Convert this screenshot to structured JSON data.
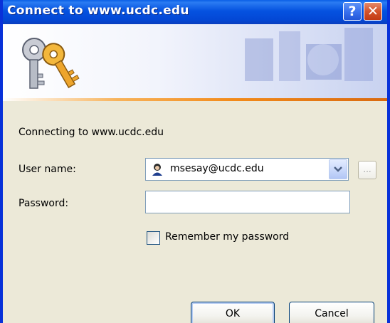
{
  "window": {
    "title": "Connect to www.ucdc.edu",
    "help_label": "?",
    "close_label": "✕"
  },
  "dialog": {
    "connecting_text": "Connecting to www.ucdc.edu",
    "username_label": "User name:",
    "username_value": "msesay@ucdc.edu",
    "password_label": "Password:",
    "password_value": "",
    "browse_label": "...",
    "remember_label": "Remember my password",
    "remember_checked": false,
    "ok_label": "OK",
    "cancel_label": "Cancel"
  },
  "icons": {
    "banner": "keys-icon",
    "user": "user-avatar-icon",
    "dropdown": "chevron-down-icon"
  },
  "colors": {
    "titlebar": "#0552e0",
    "frame": "#0831d9",
    "dialog_bg": "#ece9d8",
    "accent_stripe": "#f28a1a",
    "close_button": "#d4532b"
  }
}
